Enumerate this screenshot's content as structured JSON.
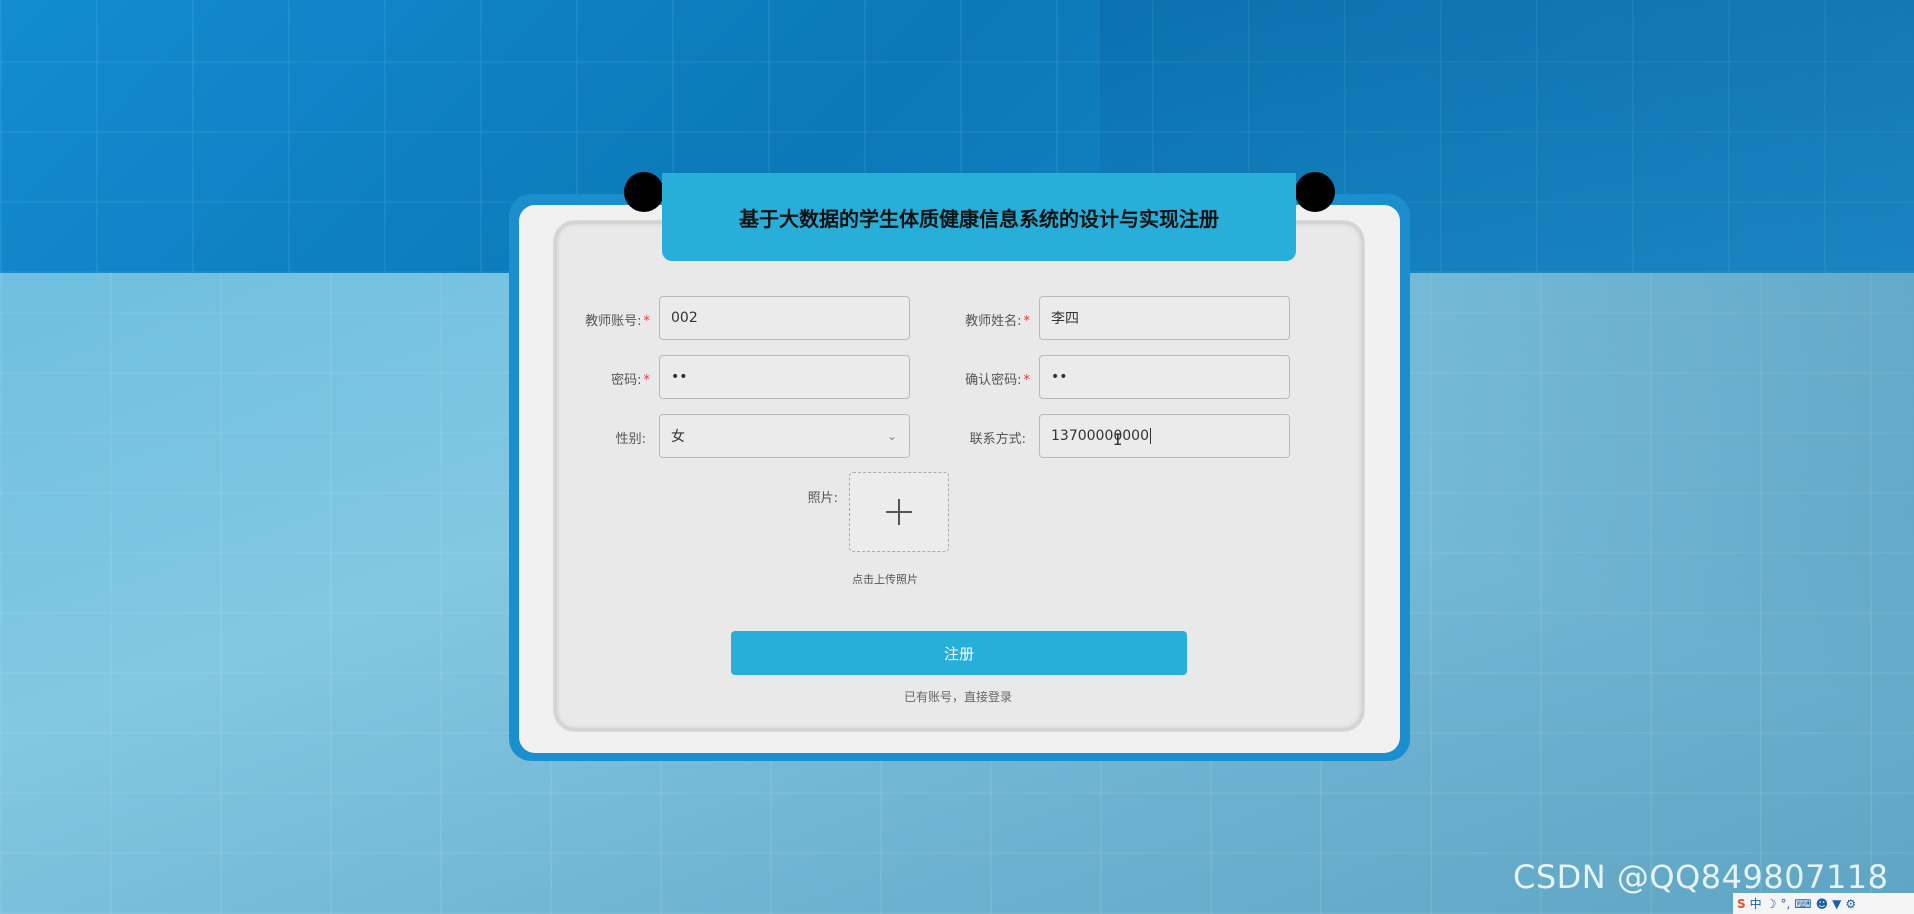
{
  "title": "基于大数据的学生体质健康信息系统的设计与实现注册",
  "form": {
    "account": {
      "label": "教师账号:",
      "value": "002",
      "required": true
    },
    "name": {
      "label": "教师姓名:",
      "value": "李四",
      "required": true
    },
    "password": {
      "label": "密码:",
      "value": "••",
      "required": true
    },
    "confirm_password": {
      "label": "确认密码:",
      "value": "••",
      "required": true
    },
    "gender": {
      "label": "性别:",
      "value": "女"
    },
    "contact": {
      "label": "联系方式:",
      "value": "13700000000"
    },
    "photo": {
      "label": "照片:",
      "hint": "点击上传照片"
    },
    "required_mark": "*"
  },
  "submit_label": "注册",
  "login_link": "已有账号，直接登录",
  "watermark": "CSDN @QQ849807118",
  "tray": {
    "ime_logo": "S",
    "ime_mode": "中",
    "icons": [
      "moon-icon",
      "punctuation-icon",
      "keyboard-icon",
      "user-icon",
      "shirt-icon",
      "wrench-icon"
    ]
  },
  "colors": {
    "accent": "#27afd9",
    "card_border": "#1b8ecd",
    "required": "#e33333"
  }
}
